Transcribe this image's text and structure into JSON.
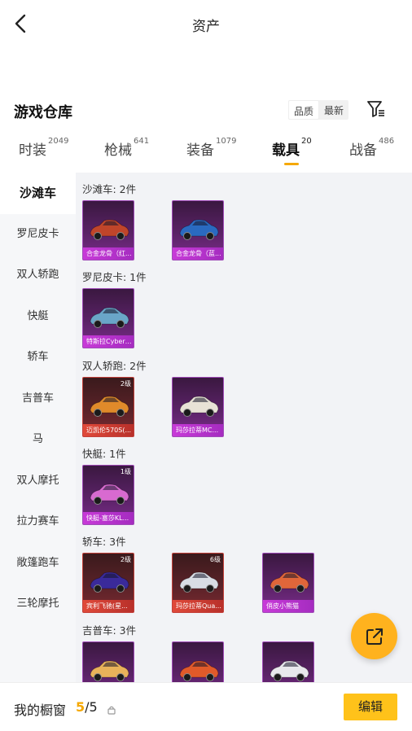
{
  "header": {
    "title": "资产",
    "back_icon": "chevron-left-icon"
  },
  "warehouse": {
    "title": "游戏仓库",
    "sort_options": [
      "品质",
      "最新"
    ],
    "sort_selected": "品质",
    "filter_icon": "filter-icon"
  },
  "tabs": [
    {
      "label": "时装",
      "count": "2049",
      "active": false
    },
    {
      "label": "枪械",
      "count": "641",
      "active": false
    },
    {
      "label": "装备",
      "count": "1079",
      "active": false
    },
    {
      "label": "载具",
      "count": "20",
      "active": true
    },
    {
      "label": "战备",
      "count": "486",
      "active": false
    }
  ],
  "sidebar": {
    "items": [
      "沙滩车",
      "罗尼皮卡",
      "双人轿跑",
      "快艇",
      "轿车",
      "吉普车",
      "马",
      "双人摩托",
      "拉力赛车",
      "敞篷跑车",
      "三轮摩托"
    ],
    "active": "沙滩车"
  },
  "categories": [
    {
      "heading": "沙滩车: 2件",
      "items": [
        {
          "label": "合金龙骨（红...",
          "level": "",
          "rarity": "purple",
          "car_color": "#c0452a"
        },
        {
          "label": "合金龙骨（蓝...",
          "level": "",
          "rarity": "purple",
          "car_color": "#2a6ac0"
        }
      ]
    },
    {
      "heading": "罗尼皮卡: 1件",
      "items": [
        {
          "label": "特斯拉Cybert...",
          "level": "",
          "rarity": "purple",
          "car_color": "#6aa6c8"
        }
      ]
    },
    {
      "heading": "双人轿跑: 2件",
      "items": [
        {
          "label": "迈凯伦570S(...",
          "level": "2级",
          "rarity": "red",
          "car_color": "#e08a2a"
        },
        {
          "label": "玛莎拉蒂MC...",
          "level": "",
          "rarity": "purple",
          "car_color": "#e8e2d6"
        }
      ]
    },
    {
      "heading": "快艇: 1件",
      "items": [
        {
          "label": "快艇-塞莎KL...",
          "level": "1级",
          "rarity": "purple",
          "car_color": "#d86ad0"
        }
      ]
    },
    {
      "heading": "轿车: 3件",
      "items": [
        {
          "label": "宾利飞驰(星...",
          "level": "2级",
          "rarity": "red",
          "car_color": "#3a2a9a"
        },
        {
          "label": "玛莎拉蒂Qua...",
          "level": "6级",
          "rarity": "red",
          "car_color": "#d8dce4"
        },
        {
          "label": "俏皮小熊猫",
          "level": "",
          "rarity": "purple",
          "car_color": "#e0663a"
        }
      ]
    },
    {
      "heading": "吉普车: 3件",
      "items": [
        {
          "label": "",
          "level": "",
          "rarity": "purple",
          "car_color": "#e8b25a"
        },
        {
          "label": "",
          "level": "",
          "rarity": "purple",
          "car_color": "#e05a2a"
        },
        {
          "label": "",
          "level": "",
          "rarity": "purple",
          "car_color": "#e8e8ec"
        }
      ]
    }
  ],
  "bottom_bar": {
    "label": "我的橱窗",
    "count_current": "5",
    "count_total": "/5",
    "lock_icon": "lock-icon",
    "edit_label": "编辑"
  },
  "fab": {
    "icon": "share-icon"
  },
  "colors": {
    "accent": "#ffc21a",
    "rarity_purple": "#a04ab8",
    "rarity_red": "#c4403a"
  }
}
